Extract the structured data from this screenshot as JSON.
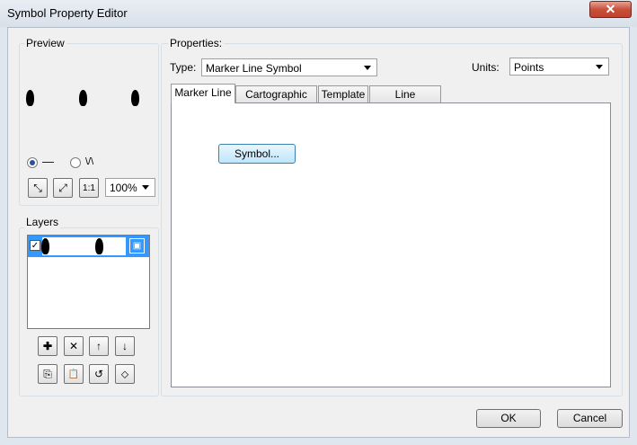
{
  "window": {
    "title": "Symbol Property Editor",
    "close_glyph": "✕"
  },
  "preview": {
    "label": "Preview",
    "line_icon": "—",
    "wave_icon": "\\/\\",
    "zoom": "100%",
    "tool_icons": {
      "shrink": "⤡",
      "expand": "⤢",
      "actual": "1:1"
    }
  },
  "layers": {
    "label": "Layers",
    "tool_icons": {
      "add": "✚",
      "remove": "✕",
      "up": "↑",
      "down": "↓",
      "copy": "⎘",
      "paste": "📋",
      "reset": "↺",
      "tag": "⬦"
    }
  },
  "properties": {
    "label": "Properties:",
    "type_label": "Type:",
    "type_value": "Marker Line Symbol",
    "units_label": "Units:",
    "units_value": "Points",
    "tabs": [
      "Marker Line",
      "Cartographic Line",
      "Template",
      "Line Properties"
    ],
    "symbol_button": "Symbol..."
  },
  "footer": {
    "ok": "OK",
    "cancel": "Cancel"
  }
}
